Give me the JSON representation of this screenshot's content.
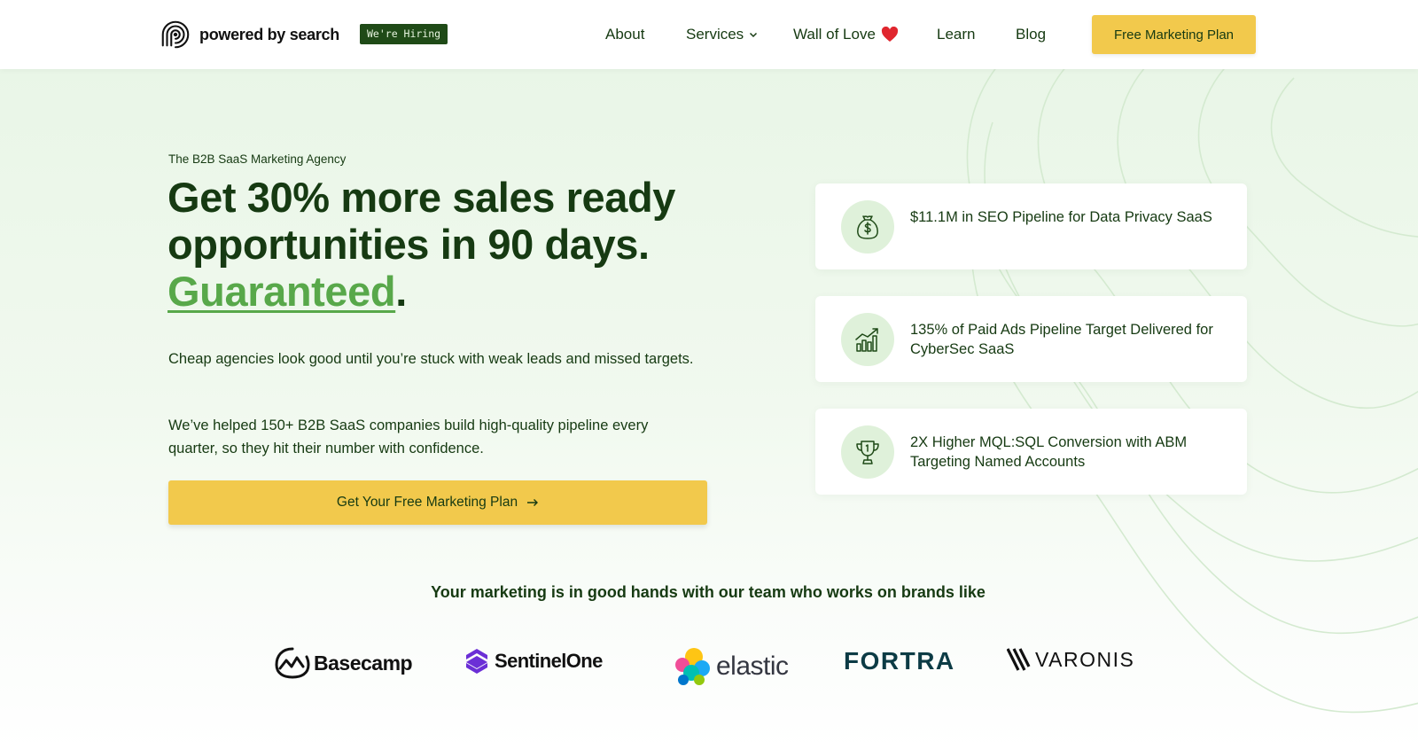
{
  "header": {
    "logo_text": "powered by search",
    "hiring_badge": "We're Hiring",
    "nav": [
      {
        "label": "About"
      },
      {
        "label": "Services"
      },
      {
        "label": "Wall of Love"
      },
      {
        "label": "Learn"
      },
      {
        "label": "Blog"
      }
    ],
    "cta": "Free Marketing Plan"
  },
  "hero": {
    "eyebrow": "The B2B SaaS Marketing Agency",
    "headline_line1": "Get 30% more sales ready",
    "headline_line2": "opportunities in 90 days.",
    "headline_accent": "Guaranteed",
    "headline_period": ".",
    "paragraph1": "Cheap agencies look good until you’re stuck with weak leads and missed targets.",
    "paragraph2": "We’ve helped 150+ B2B SaaS companies build high-quality pipeline every quarter, so they hit their number with confidence.",
    "cta": "Get Your Free Marketing Plan"
  },
  "stats": [
    {
      "icon": "money-bag-icon",
      "text": "$11.1M in SEO Pipeline for Data Privacy SaaS"
    },
    {
      "icon": "growth-chart-icon",
      "text": "135% of Paid Ads Pipeline Target Delivered for CyberSec SaaS"
    },
    {
      "icon": "trophy-icon",
      "text": "2X Higher MQL:SQL Conversion with ABM Targeting Named Accounts"
    }
  ],
  "brands": {
    "title": "Your marketing is in good hands with our team who works on brands like",
    "logos": [
      {
        "name": "Basecamp"
      },
      {
        "name": "SentinelOne"
      },
      {
        "name": "elastic"
      },
      {
        "name": "FORTRA"
      },
      {
        "name": "VARONIS"
      }
    ]
  },
  "colors": {
    "brand_dark_green": "#163a12",
    "accent_green": "#58a84a",
    "cta_yellow": "#f2c94c",
    "hero_bg": "#e9f6e7"
  }
}
